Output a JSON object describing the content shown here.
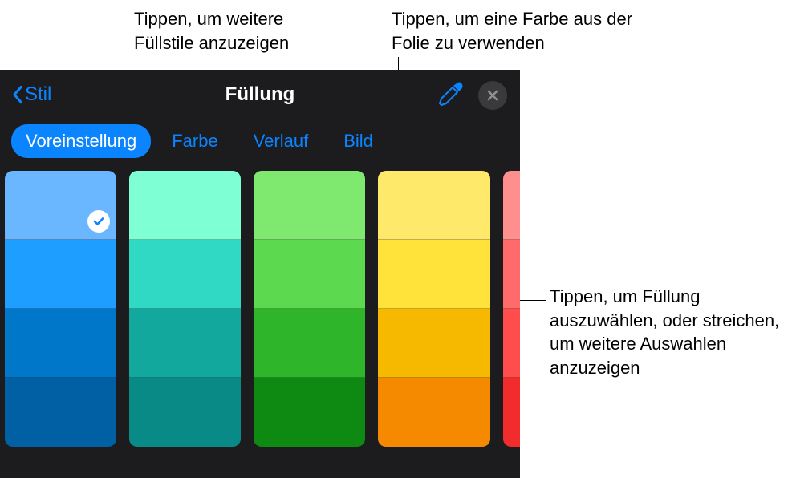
{
  "callouts": {
    "top_left": "Tippen, um weitere Füllstile anzuzeigen",
    "top_right": "Tippen, um eine Farbe aus der Folie zu verwenden",
    "right": "Tippen, um Füllung auszuwählen, oder streichen, um weitere Auswahlen anzuzeigen"
  },
  "panel": {
    "back_label": "Stil",
    "title": "Füllung",
    "tabs": {
      "preset": "Voreinstellung",
      "color": "Farbe",
      "gradient": "Verlauf",
      "image": "Bild"
    }
  },
  "swatches": {
    "columns": [
      [
        "#6bb7ff",
        "#1e9fff",
        "#0077c8",
        "#0060a3"
      ],
      [
        "#7fffd4",
        "#2fd9c4",
        "#13a89e",
        "#0a8a86"
      ],
      [
        "#7fe96f",
        "#5cd94f",
        "#2fb52a",
        "#0e8a12"
      ],
      [
        "#ffe96b",
        "#ffe23a",
        "#f7b800",
        "#f58a00"
      ]
    ],
    "partial": [
      "#ff8f8f",
      "#ff6b6b",
      "#ff4d4d",
      "#f22c2c"
    ]
  }
}
